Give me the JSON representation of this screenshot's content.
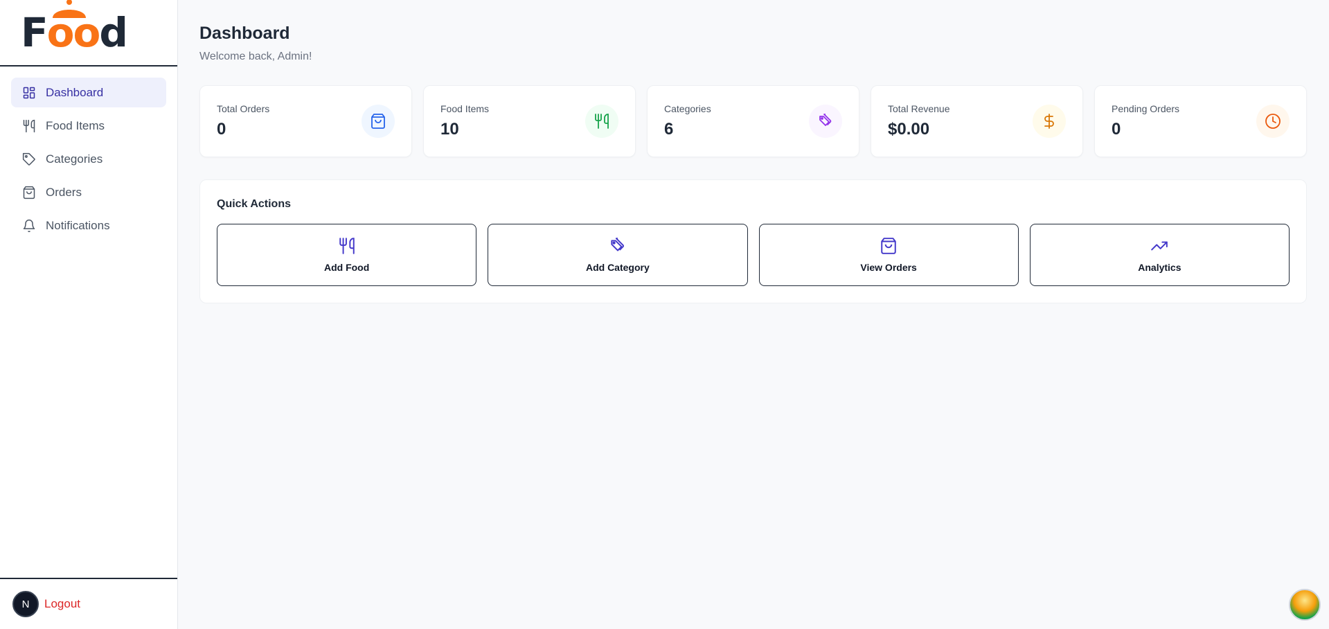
{
  "brand": {
    "logo_text_f": "F",
    "logo_text_oo": "oo",
    "logo_text_d": "d",
    "accent": "#f97316"
  },
  "sidebar": {
    "items": [
      {
        "label": "Dashboard",
        "icon": "dashboard-grid-icon",
        "active": true
      },
      {
        "label": "Food Items",
        "icon": "utensils-icon"
      },
      {
        "label": "Categories",
        "icon": "tag-icon"
      },
      {
        "label": "Orders",
        "icon": "shopping-bag-icon"
      },
      {
        "label": "Notifications",
        "icon": "bell-icon"
      }
    ],
    "avatar_letter": "N",
    "logout_label": "Logout"
  },
  "header": {
    "title": "Dashboard",
    "welcome": "Welcome back, Admin!"
  },
  "stats": [
    {
      "label": "Total Orders",
      "value": "0",
      "icon": "shopping-bag-icon",
      "color": "#2563eb",
      "bg": "#eff6ff"
    },
    {
      "label": "Food Items",
      "value": "10",
      "icon": "utensils-icon",
      "color": "#16a34a",
      "bg": "#f0fdf4"
    },
    {
      "label": "Categories",
      "value": "6",
      "icon": "tag-icon",
      "color": "#9333ea",
      "bg": "#faf5ff"
    },
    {
      "label": "Total Revenue",
      "value": "$0.00",
      "icon": "dollar-icon",
      "color": "#d97706",
      "bg": "#fffbeb"
    },
    {
      "label": "Pending Orders",
      "value": "0",
      "icon": "clock-icon",
      "color": "#ea580c",
      "bg": "#fff7ed"
    }
  ],
  "quick_actions": {
    "title": "Quick Actions",
    "color": "#4338ca",
    "items": [
      {
        "label": "Add Food",
        "icon": "utensils-icon"
      },
      {
        "label": "Add Category",
        "icon": "tag-icon"
      },
      {
        "label": "View Orders",
        "icon": "shopping-bag-icon"
      },
      {
        "label": "Analytics",
        "icon": "trending-up-icon"
      }
    ]
  }
}
